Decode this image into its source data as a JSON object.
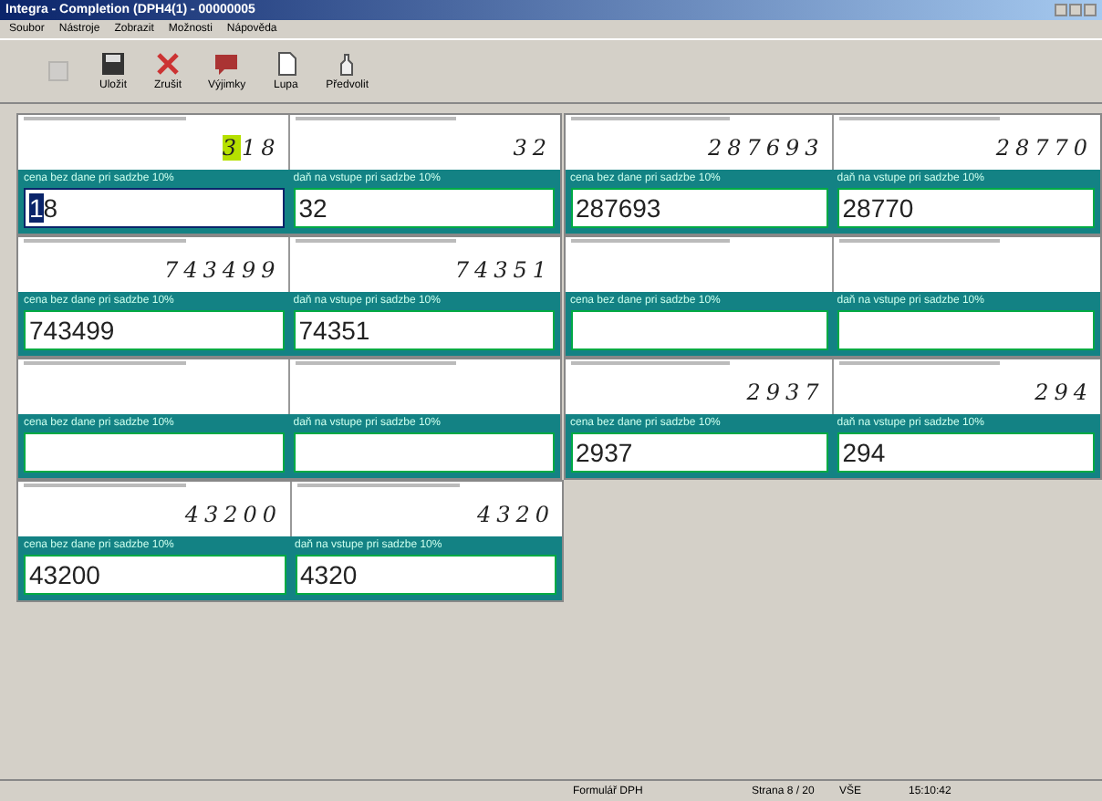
{
  "window": {
    "title": "Integra - Completion (DPH4(1) - 00000005"
  },
  "menu": [
    "Soubor",
    "Nástroje",
    "Zobrazit",
    "Možnosti",
    "Nápověda"
  ],
  "toolbar": [
    {
      "kind": "page",
      "disabled": true
    },
    {
      "kind": "save",
      "label": "Uložit",
      "disabled": false
    },
    {
      "kind": "cancel",
      "label": "Zrušit",
      "disabled": false
    },
    {
      "kind": "exceptions",
      "label": "Výjimky",
      "disabled": false
    },
    {
      "kind": "zoom",
      "label": "Lupa",
      "disabled": false
    },
    {
      "kind": "preset",
      "label": "Předvolit",
      "disabled": false
    }
  ],
  "rows": [
    {
      "cards": [
        {
          "fields": [
            {
              "label": "cena bez dane pri sadzbe 10%",
              "scan": "318",
              "value": "18",
              "focused": true
            },
            {
              "label": "daň na vstupe pri sadzbe 10%",
              "scan": "32",
              "value": "32",
              "focused": false
            }
          ]
        },
        {
          "fields": [
            {
              "label": "cena bez dane pri sadzbe 10%",
              "scan": "287693",
              "value": "287693",
              "focused": false
            },
            {
              "label": "daň na vstupe pri sadzbe 10%",
              "scan": "28770",
              "value": "28770",
              "focused": false
            }
          ]
        }
      ]
    },
    {
      "cards": [
        {
          "fields": [
            {
              "label": "cena bez dane pri sadzbe 10%",
              "scan": "743499",
              "value": "743499",
              "focused": false
            },
            {
              "label": "daň na vstupe pri sadzbe 10%",
              "scan": "74351",
              "value": "74351",
              "focused": false
            }
          ]
        },
        {
          "fields": [
            {
              "label": "cena bez dane pri sadzbe 10%",
              "focused": false
            },
            {
              "label": "daň na vstupe pri sadzbe 10%",
              "focused": false
            }
          ]
        }
      ]
    },
    {
      "cards": [
        {
          "fields": [
            {
              "label": "cena bez dane pri sadzbe 10%",
              "focused": false
            },
            {
              "label": "daň na vstupe pri sadzbe 10%",
              "focused": false
            }
          ]
        },
        {
          "fields": [
            {
              "label": "cena bez dane pri sadzbe 10%",
              "scan": "2937",
              "value": "2937",
              "focused": false
            },
            {
              "label": "daň na vstupe pri sadzbe 10%",
              "scan": "294",
              "value": "294",
              "focused": false
            }
          ]
        }
      ]
    },
    {
      "cards": [
        {
          "fields": [
            {
              "label": "cena bez dane pri sadzbe 10%",
              "scan": "43200",
              "value": "43200",
              "focused": false
            },
            {
              "label": "daň na vstupe pri sadzbe 10%",
              "scan": "4320",
              "value": "4320",
              "focused": false
            }
          ]
        }
      ]
    }
  ],
  "status_bar": [
    "Formulář DPH",
    "Strana 8 / 20",
    "VŠE",
    "15:10:42"
  ]
}
